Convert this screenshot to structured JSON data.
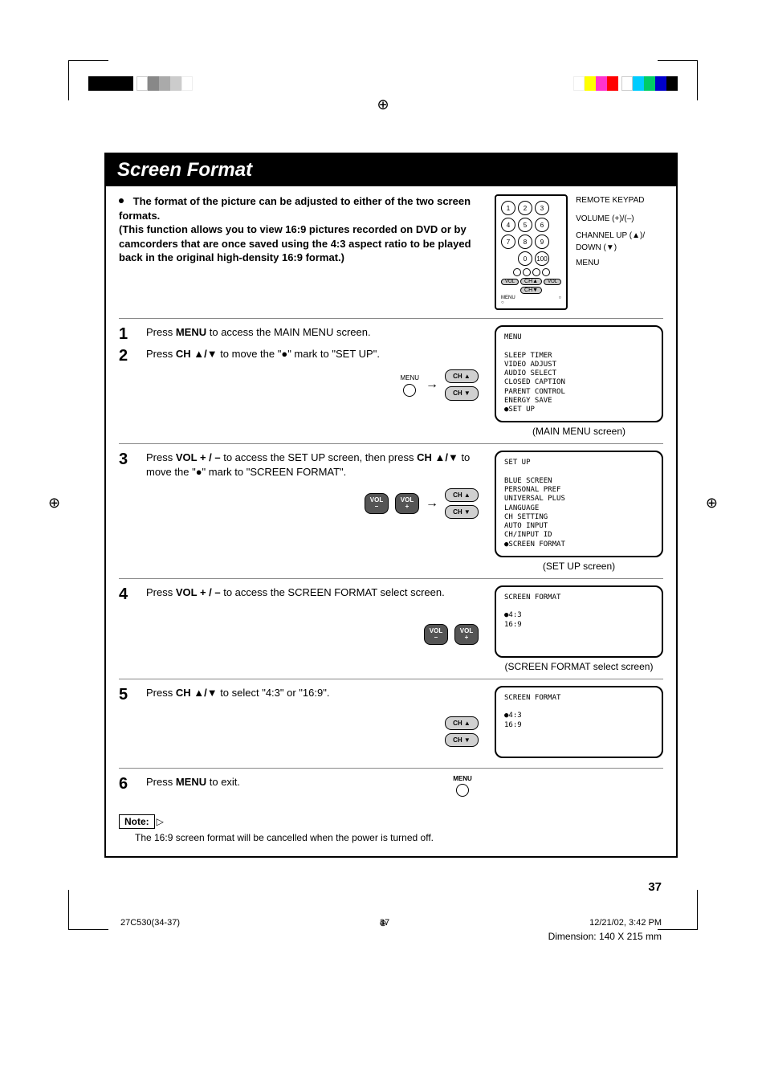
{
  "title": "Screen Format",
  "intro": {
    "main": "The format of the picture can be adjusted to either of the two screen formats.",
    "sub": "(This function allows you to view 16:9 pictures recorded on DVD or by camcorders that are once saved using the 4:3 aspect ratio to be played back in the original high-density 16:9 format.)"
  },
  "remote": {
    "labels": {
      "keypad": "REMOTE KEYPAD",
      "volume": "VOLUME (+)/(–)",
      "channel": "CHANNEL UP (▲)/ DOWN (▼)",
      "menu": "MENU"
    }
  },
  "steps": [
    {
      "num": "1",
      "text_a": "Press ",
      "bold_a": "MENU",
      "text_b": " to access the MAIN MENU screen."
    },
    {
      "num": "2",
      "text_a": "Press ",
      "bold_a": "CH ▲/▼",
      "text_b": " to move the \"●\" mark to \"SET UP\"."
    },
    {
      "num": "3",
      "text_a": "Press ",
      "bold_a": "VOL + / –",
      "text_b": " to access the SET UP screen, then press ",
      "bold_b": "CH ▲/▼",
      "text_c": " to move the \"●\" mark to \"SCREEN FORMAT\"."
    },
    {
      "num": "4",
      "text_a": "Press ",
      "bold_a": "VOL + / –",
      "text_b": " to access the SCREEN FORMAT select screen."
    },
    {
      "num": "5",
      "text_a": "Press ",
      "bold_a": "CH ▲/▼",
      "text_b": " to select \"4:3\" or \"16:9\"."
    },
    {
      "num": "6",
      "text_a": "Press ",
      "bold_a": "MENU",
      "text_b": " to exit."
    }
  ],
  "osd": {
    "main_menu": {
      "title": "MENU",
      "items": [
        "SLEEP TIMER",
        "VIDEO ADJUST",
        "AUDIO SELECT",
        "CLOSED CAPTION",
        "PARENT CONTROL",
        "ENERGY SAVE",
        "●SET UP"
      ],
      "caption": "(MAIN MENU screen)"
    },
    "setup": {
      "title": "SET UP",
      "items": [
        "BLUE SCREEN",
        "PERSONAL PREF",
        "UNIVERSAL PLUS",
        "LANGUAGE",
        "CH SETTING",
        "AUTO INPUT",
        "CH/INPUT ID",
        "●SCREEN FORMAT"
      ],
      "caption": "(SET UP screen)"
    },
    "format_select": {
      "title": "SCREEN FORMAT",
      "items": [
        "●4:3",
        " 16:9"
      ],
      "caption": "(SCREEN FORMAT select screen)"
    },
    "format_select2": {
      "title": "SCREEN FORMAT",
      "items": [
        "●4:3",
        " 16:9"
      ]
    }
  },
  "buttons": {
    "menu": "MENU",
    "ch_up": "CH ▲",
    "ch_dn": "CH ▼",
    "vol_minus": "VOL\n–",
    "vol_plus": "VOL\n+"
  },
  "note": {
    "label": "Note:",
    "text": "The 16:9 screen format will be cancelled when the power is turned off."
  },
  "page_num": "37",
  "footer": {
    "left": "27C530(34-37)",
    "center": "37",
    "right": "12/21/02, 3:42 PM",
    "dimension": "Dimension: 140  X 215 mm"
  }
}
